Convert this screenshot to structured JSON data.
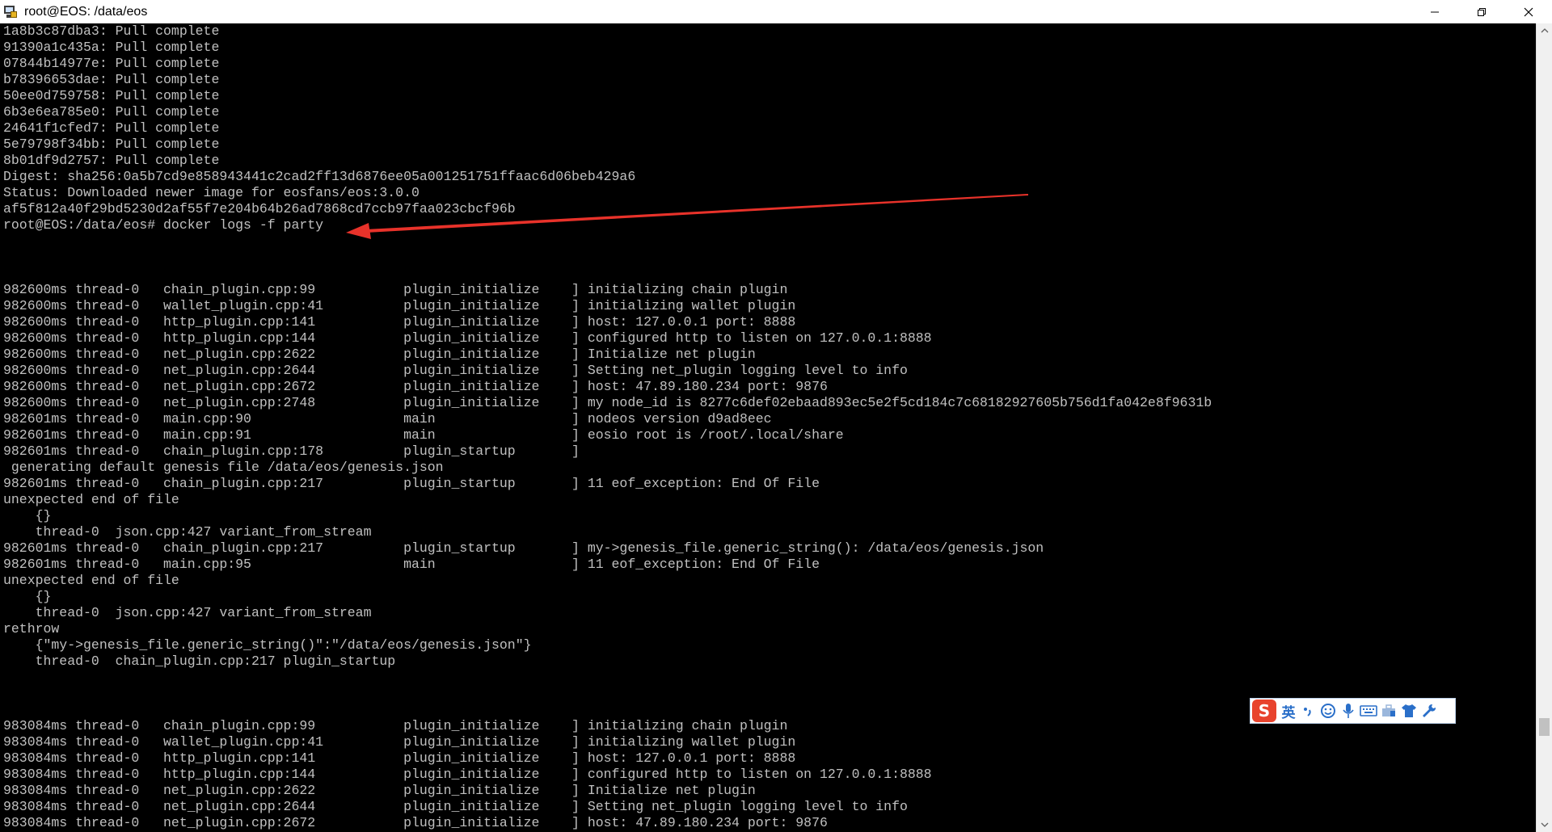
{
  "window": {
    "title": "root@EOS: /data/eos"
  },
  "terminal": {
    "lines": [
      "1a8b3c87dba3: Pull complete",
      "91390a1c435a: Pull complete",
      "07844b14977e: Pull complete",
      "b78396653dae: Pull complete",
      "50ee0d759758: Pull complete",
      "6b3e6ea785e0: Pull complete",
      "24641f1cfed7: Pull complete",
      "5e79798f34bb: Pull complete",
      "8b01df9d2757: Pull complete",
      "Digest: sha256:0a5b7cd9e858943441c2cad2ff13d6876ee05a001251751ffaac6d06beb429a6",
      "Status: Downloaded newer image for eosfans/eos:3.0.0",
      "af5f812a40f29bd5230d2af55f7e204b64b26ad7868cd7ccb97faa023cbcf96b",
      "root@EOS:/data/eos# docker logs -f party",
      "",
      "",
      "",
      "982600ms thread-0   chain_plugin.cpp:99           plugin_initialize    ] initializing chain plugin",
      "982600ms thread-0   wallet_plugin.cpp:41          plugin_initialize    ] initializing wallet plugin",
      "982600ms thread-0   http_plugin.cpp:141           plugin_initialize    ] host: 127.0.0.1 port: 8888",
      "982600ms thread-0   http_plugin.cpp:144           plugin_initialize    ] configured http to listen on 127.0.0.1:8888",
      "982600ms thread-0   net_plugin.cpp:2622           plugin_initialize    ] Initialize net plugin",
      "982600ms thread-0   net_plugin.cpp:2644           plugin_initialize    ] Setting net_plugin logging level to info",
      "982600ms thread-0   net_plugin.cpp:2672           plugin_initialize    ] host: 47.89.180.234 port: 9876",
      "982600ms thread-0   net_plugin.cpp:2748           plugin_initialize    ] my node_id is 8277c6def02ebaad893ec5e2f5cd184c7c68182927605b756d1fa042e8f9631b",
      "982601ms thread-0   main.cpp:90                   main                 ] nodeos version d9ad8eec",
      "982601ms thread-0   main.cpp:91                   main                 ] eosio root is /root/.local/share",
      "982601ms thread-0   chain_plugin.cpp:178          plugin_startup       ]",
      " generating default genesis file /data/eos/genesis.json",
      "982601ms thread-0   chain_plugin.cpp:217          plugin_startup       ] 11 eof_exception: End Of File",
      "unexpected end of file",
      "    {}",
      "    thread-0  json.cpp:427 variant_from_stream",
      "982601ms thread-0   chain_plugin.cpp:217          plugin_startup       ] my->genesis_file.generic_string(): /data/eos/genesis.json",
      "982601ms thread-0   main.cpp:95                   main                 ] 11 eof_exception: End Of File",
      "unexpected end of file",
      "    {}",
      "    thread-0  json.cpp:427 variant_from_stream",
      "rethrow",
      "    {\"my->genesis_file.generic_string()\":\"/data/eos/genesis.json\"}",
      "    thread-0  chain_plugin.cpp:217 plugin_startup",
      "",
      "",
      "",
      "983084ms thread-0   chain_plugin.cpp:99           plugin_initialize    ] initializing chain plugin",
      "983084ms thread-0   wallet_plugin.cpp:41          plugin_initialize    ] initializing wallet plugin",
      "983084ms thread-0   http_plugin.cpp:141           plugin_initialize    ] host: 127.0.0.1 port: 8888",
      "983084ms thread-0   http_plugin.cpp:144           plugin_initialize    ] configured http to listen on 127.0.0.1:8888",
      "983084ms thread-0   net_plugin.cpp:2622           plugin_initialize    ] Initialize net plugin",
      "983084ms thread-0   net_plugin.cpp:2644           plugin_initialize    ] Setting net_plugin logging level to info",
      "983084ms thread-0   net_plugin.cpp:2672           plugin_initialize    ] host: 47.89.180.234 port: 9876"
    ]
  },
  "ime": {
    "logo": "S",
    "lang": "英",
    "icons": [
      "punctuation-icon",
      "emoji-icon",
      "microphone-icon",
      "keyboard-icon",
      "toolbox-icon",
      "skin-icon",
      "settings-icon"
    ]
  },
  "colors": {
    "terminal_bg": "#000000",
    "terminal_fg": "#c0c0c0",
    "annotation_arrow": "#e8322a",
    "ime_brand": "#e8432d",
    "ime_icon": "#2a6fc9"
  }
}
